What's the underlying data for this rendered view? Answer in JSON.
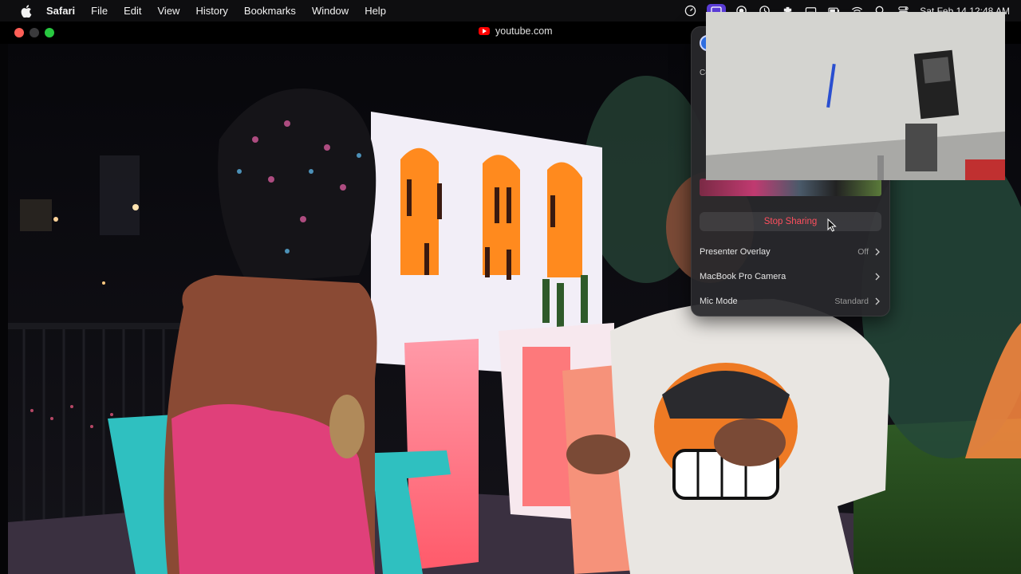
{
  "menubar": {
    "app_name": "Safari",
    "menus": [
      "File",
      "Edit",
      "View",
      "History",
      "Bookmarks",
      "Window",
      "Help"
    ],
    "clock": "Sat Feb 14  12:48 AM"
  },
  "window": {
    "url": "youtube.com",
    "favicon": "youtube-favicon"
  },
  "control_center": {
    "section_label": "Co",
    "stop_sharing_label": "Stop Sharing",
    "rows": [
      {
        "label": "Presenter Overlay",
        "value": "Off"
      },
      {
        "label": "MacBook Pro Camera",
        "value": ""
      },
      {
        "label": "Mic Mode",
        "value": "Standard"
      }
    ]
  },
  "colors": {
    "accent": "#5a3cd6",
    "stop_sharing": "#ff4f5e",
    "close": "#ff5f57",
    "maximize": "#28c840"
  }
}
